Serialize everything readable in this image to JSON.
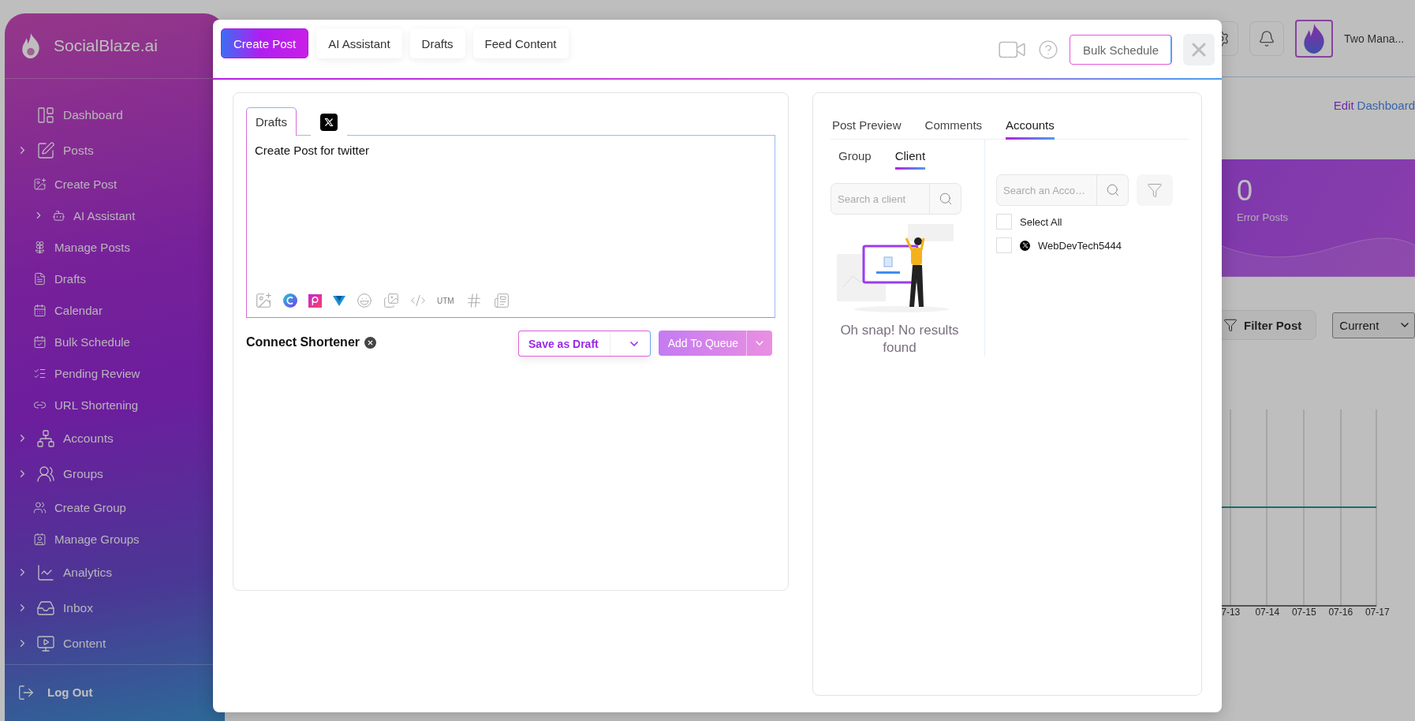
{
  "sidebar": {
    "brand": "SocialBlaze.ai",
    "items": [
      {
        "label": "Dashboard",
        "has_submenu": false
      },
      {
        "label": "Posts",
        "has_submenu": true,
        "children": [
          {
            "label": "Create Post",
            "has_submenu": false
          },
          {
            "label": "AI Assistant",
            "has_submenu": true
          },
          {
            "label": "Manage Posts",
            "has_submenu": false
          },
          {
            "label": "Drafts",
            "has_submenu": false
          },
          {
            "label": "Calendar",
            "has_submenu": false
          },
          {
            "label": "Bulk Schedule",
            "has_submenu": false
          },
          {
            "label": "Pending Review",
            "has_submenu": false
          },
          {
            "label": "URL Shortening",
            "has_submenu": false
          }
        ]
      },
      {
        "label": "Accounts",
        "has_submenu": true
      },
      {
        "label": "Groups",
        "has_submenu": true,
        "children": [
          {
            "label": "Create Group",
            "has_submenu": false
          },
          {
            "label": "Manage Groups",
            "has_submenu": false
          }
        ]
      },
      {
        "label": "Analytics",
        "has_submenu": true
      },
      {
        "label": "Inbox",
        "has_submenu": true
      },
      {
        "label": "Content",
        "has_submenu": true
      }
    ],
    "logout": "Log Out"
  },
  "background": {
    "user_name": "Two Mana...",
    "edit_link": {
      "verb": "Edit",
      "target": "Dashboard"
    },
    "stat": {
      "value": "0",
      "label": "Error Posts"
    },
    "filter_button": "Filter Post",
    "period_select": "Current",
    "chart_x_labels": [
      "7-13",
      "07-14",
      "07-15",
      "07-16",
      "07-17"
    ]
  },
  "modal": {
    "tabs": [
      {
        "label": "Create Post",
        "selected": true
      },
      {
        "label": "AI Assistant",
        "selected": false
      },
      {
        "label": "Drafts",
        "selected": false
      },
      {
        "label": "Feed Content",
        "selected": false
      }
    ],
    "bulk_schedule": "Bulk Schedule",
    "editor": {
      "tabs": [
        {
          "kind": "text",
          "label": "Drafts",
          "selected": true
        },
        {
          "kind": "x-logo",
          "selected": false
        }
      ],
      "text": "Create Post for twitter",
      "utm": "UTM",
      "shortener": "Connect Shortener",
      "save_draft": "Save as Draft",
      "add_queue": "Add To Queue"
    },
    "preview": {
      "tabs": [
        {
          "label": "Post Preview",
          "selected": false
        },
        {
          "label": "Comments",
          "selected": false
        },
        {
          "label": "Accounts",
          "selected": true
        }
      ],
      "subtabs": [
        {
          "label": "Group",
          "selected": false
        },
        {
          "label": "Client",
          "selected": true
        }
      ],
      "client_search": {
        "placeholder": "Search a client"
      },
      "empty_message": "Oh snap! No results found",
      "account_search": {
        "placeholder": "Search an Acco…"
      },
      "select_all": {
        "label": "Select All",
        "checked": false
      },
      "accounts": [
        {
          "name": "WebDevTech5444",
          "checked": false
        }
      ]
    }
  }
}
